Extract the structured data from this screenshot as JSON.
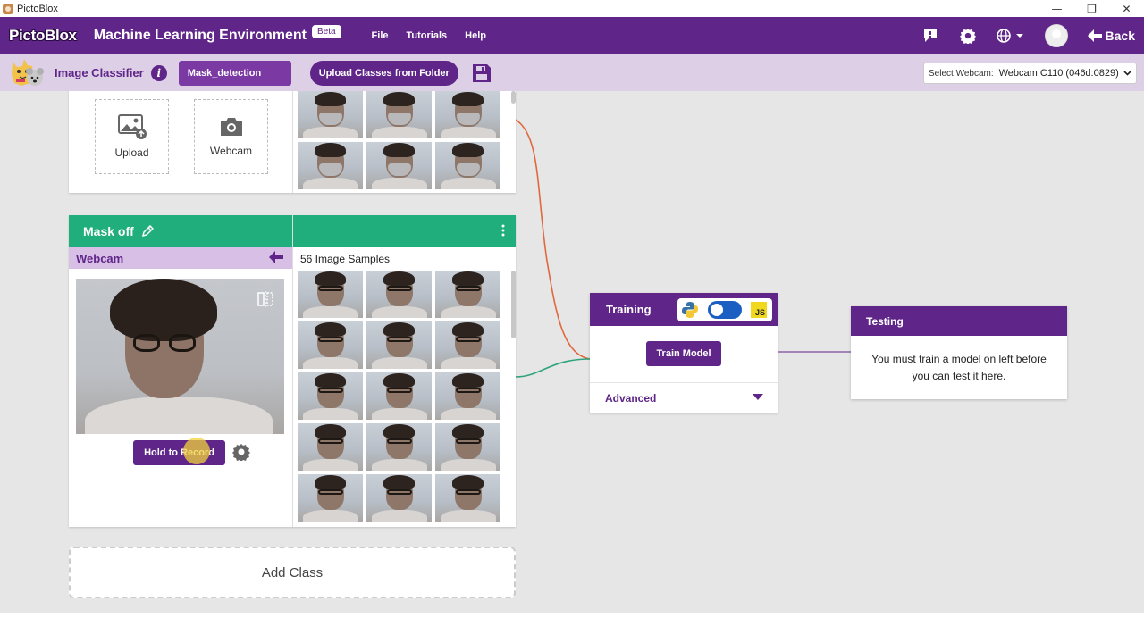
{
  "window": {
    "title": "PictoBlox",
    "controls": [
      "—",
      "❐",
      "✕"
    ]
  },
  "topbar": {
    "logo": "PictoBlox",
    "title": "Machine Learning Environment",
    "badge": "Beta",
    "menu": [
      "File",
      "Tutorials",
      "Help"
    ],
    "back_label": "Back",
    "icons": [
      "feedback-icon",
      "settings-icon",
      "language-globe-icon",
      "profile-avatar"
    ],
    "accent": "#5f2588"
  },
  "subbar": {
    "title": "Image Classifier",
    "project_name": "Mask_detection",
    "upload_folder_label": "Upload Classes from Folder",
    "webcam_label": "Select Webcam:",
    "webcam_value": "Webcam C110 (046d:0829)"
  },
  "class_mask_on": {
    "upload_label": "Upload",
    "webcam_label": "Webcam",
    "thumbnail_count_visible": 6
  },
  "class_mask_off": {
    "name": "Mask off",
    "header_color": "#1fae7c",
    "source": "Webcam",
    "samples_label": "56 Image Samples",
    "record_label": "Hold to Record",
    "thumbnail_count_visible": 15
  },
  "add_class_label": "Add Class",
  "training": {
    "title": "Training",
    "train_button": "Train Model",
    "advanced_label": "Advanced",
    "js_label": "JS"
  },
  "testing": {
    "title": "Testing",
    "message": "You must train a model on left before you can test it here."
  }
}
